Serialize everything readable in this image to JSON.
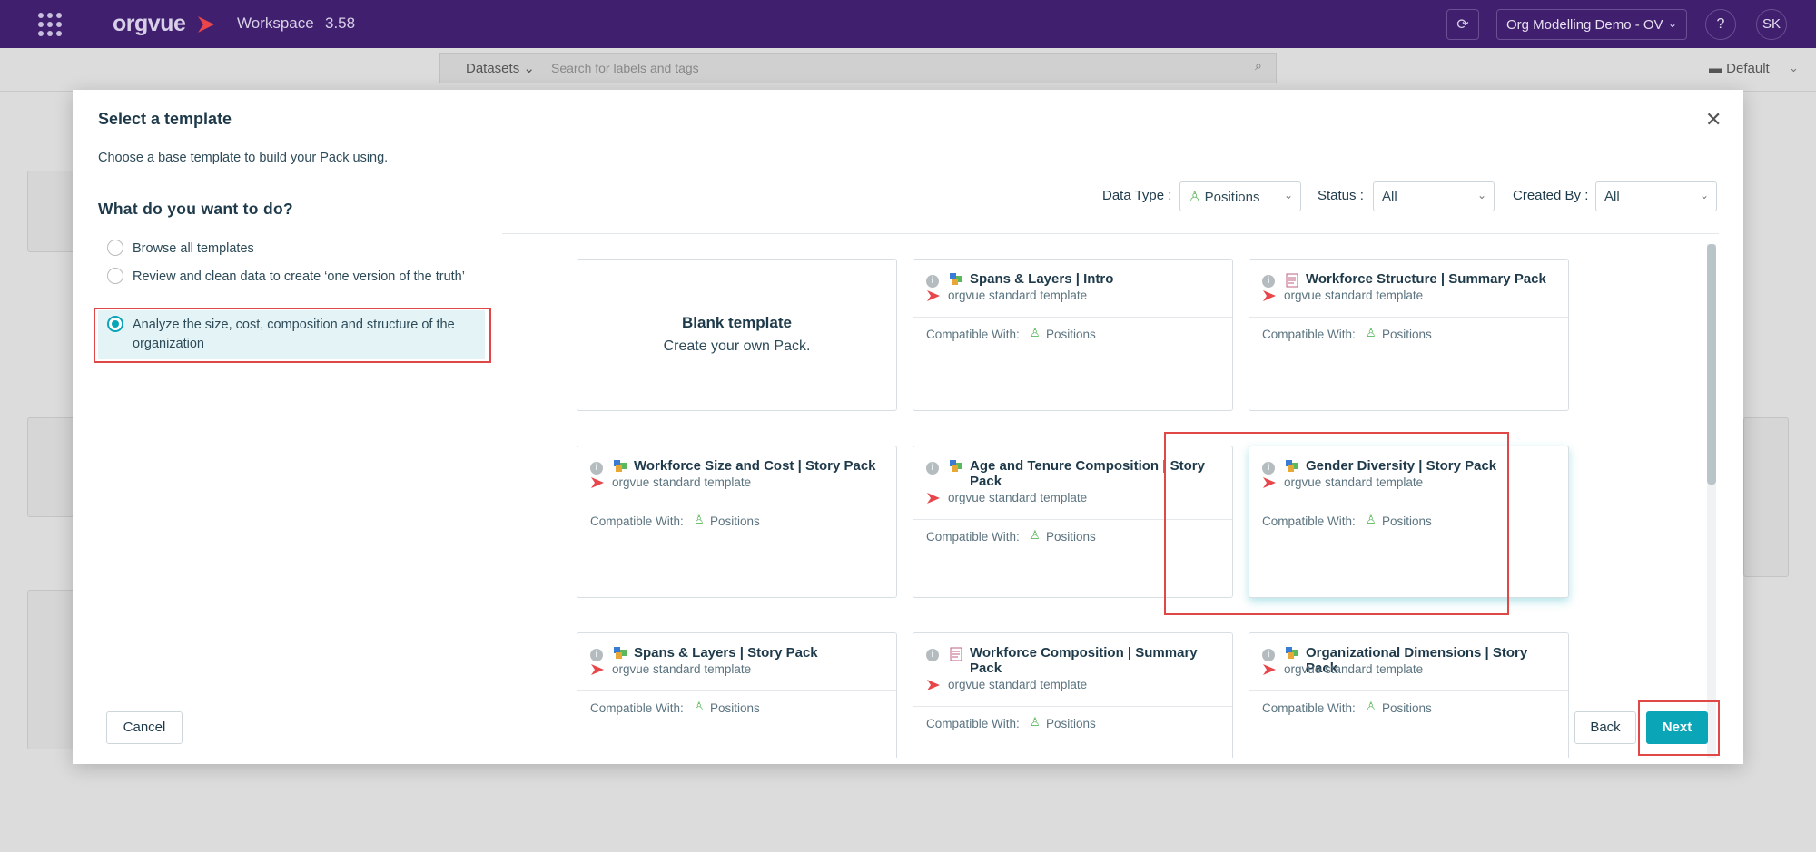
{
  "topbar": {
    "logo": "orgvue",
    "app_name": "Workspace",
    "app_version": "3.58",
    "org_select": "Org Modelling Demo - OV",
    "help": "?",
    "avatar": "SK"
  },
  "background": {
    "datasets_label": "Datasets",
    "search_placeholder": "Search for labels and tags",
    "view_label": "Default"
  },
  "modal": {
    "title": "Select a template",
    "subtitle": "Choose a base template to build your Pack using.",
    "question": "What do you want to do?",
    "options": [
      {
        "label": "Browse all templates",
        "selected": false
      },
      {
        "label": "Review and clean data to create ‘one version of the truth’",
        "selected": false
      },
      {
        "label": "Analyze the size, cost, composition and structure of the organization",
        "selected": true
      }
    ],
    "filters": {
      "data_type_label": "Data Type :",
      "data_type_value": "Positions",
      "status_label": "Status :",
      "status_value": "All",
      "created_by_label": "Created By :",
      "created_by_value": "All"
    },
    "blank_template": {
      "title": "Blank template",
      "subtitle": "Create your own Pack."
    },
    "templates": [
      {
        "title": "Spans & Layers | Intro",
        "source": "orgvue standard template",
        "compat_label": "Compatible With:",
        "compat_value": "Positions",
        "icon": "blocks-icon"
      },
      {
        "title": "Workforce Structure | Summary Pack",
        "source": "orgvue standard template",
        "compat_label": "Compatible With:",
        "compat_value": "Positions",
        "icon": "document-icon"
      },
      {
        "title": "Workforce Size and Cost | Story Pack",
        "source": "orgvue standard template",
        "compat_label": "Compatible With:",
        "compat_value": "Positions",
        "icon": "blocks-icon"
      },
      {
        "title": "Age and Tenure Composition | Story Pack",
        "source": "orgvue standard template",
        "compat_label": "Compatible With:",
        "compat_value": "Positions",
        "icon": "blocks-icon"
      },
      {
        "title": "Gender Diversity | Story Pack",
        "source": "orgvue standard template",
        "compat_label": "Compatible With:",
        "compat_value": "Positions",
        "icon": "blocks-icon"
      },
      {
        "title": "Spans & Layers | Story Pack",
        "source": "orgvue standard template",
        "compat_label": "Compatible With:",
        "compat_value": "Positions",
        "icon": "blocks-icon"
      },
      {
        "title": "Workforce Composition | Summary Pack",
        "source": "orgvue standard template",
        "compat_label": "Compatible With:",
        "compat_value": "Positions",
        "icon": "document-icon"
      },
      {
        "title": "Organizational Dimensions | Story Pack",
        "source": "orgvue standard template",
        "compat_label": "Compatible With:",
        "compat_value": "Positions",
        "icon": "blocks-icon"
      }
    ],
    "buttons": {
      "cancel": "Cancel",
      "back": "Back",
      "next": "Next"
    }
  },
  "colors": {
    "topbar": "#3f1f6e",
    "accent": "#0aa6b8",
    "highlight": "#e04848",
    "brand_red": "#e8464a"
  }
}
